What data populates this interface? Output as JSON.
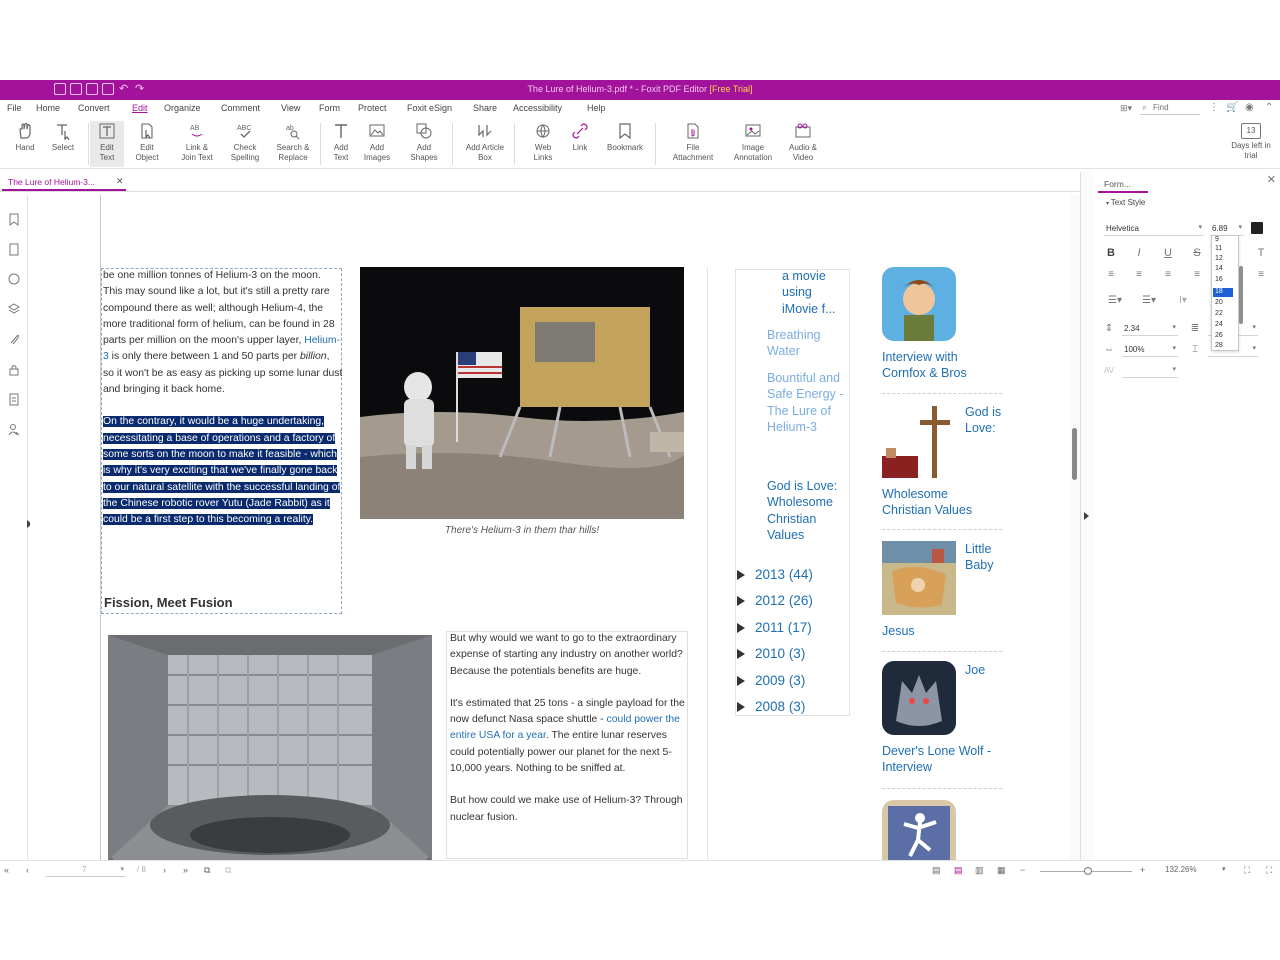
{
  "window": {
    "title": "The Lure of Helium-3.pdf * - Foxit PDF Editor",
    "trial_badge": "[Free Trial]"
  },
  "menu": [
    "File",
    "Home",
    "Convert",
    "Edit",
    "Organize",
    "Comment",
    "View",
    "Form",
    "Protect",
    "Foxit eSign",
    "Share",
    "Accessibility",
    "Help"
  ],
  "menu_active": "Edit",
  "search": {
    "placeholder": "Find"
  },
  "ribbon": {
    "tools": [
      {
        "label": "Hand"
      },
      {
        "label": "Select"
      },
      {
        "label": "Edit\nText"
      },
      {
        "label": "Edit\nObject"
      },
      {
        "label": "Link &\nJoin Text"
      },
      {
        "label": "Check\nSpelling"
      },
      {
        "label": "Search &\nReplace"
      },
      {
        "label": "Add\nText"
      },
      {
        "label": "Add\nImages"
      },
      {
        "label": "Add\nShapes"
      },
      {
        "label": "Add Article\nBox"
      },
      {
        "label": "Web\nLinks"
      },
      {
        "label": "Link"
      },
      {
        "label": "Bookmark"
      },
      {
        "label": "File\nAttachment"
      },
      {
        "label": "Image\nAnnotation"
      },
      {
        "label": "Audio &\nVideo"
      }
    ],
    "trial": {
      "days": "13",
      "label": "Days left in\ntrial"
    }
  },
  "tab": {
    "label": "The Lure of Helium-3..."
  },
  "article": {
    "para1_pre": "be one million tonnes of Helium-3 on the moon. This may sound like a lot, but it's still a pretty rare compound there as well; although Helium-4, the more traditional form of helium, can be found in 28 parts per million on the moon's upper layer, ",
    "para1_link": "Helium-3",
    "para1_mid": " is only there between 1 and 50 parts per ",
    "para1_em": "billion",
    "para1_post": ", so it won't be as easy as picking up some lunar dust and bringing it back home.",
    "para2_highlight": "On the contrary, it would be a huge undertaking, necessitating a base of operations and a factory of some sorts on the moon to make it feasible - which is why it's very exciting that we've finally gone back to our natural satellite with the successful landing of the Chinese robotic rover Yutu (Jade Rabbit) as it could be a first step to this becoming a reality.",
    "heading": "Fission, Meet Fusion",
    "caption": "There's Helium-3 in them thar hills!",
    "col2_p1": "But why would we want to go to the extraordinary expense of starting any industry on another world? Because the potentials benefits are huge.",
    "col2_p2_pre": "It's estimated that 25 tons - a single payload for the now defunct Nasa space shuttle - ",
    "col2_p2_link": "could power the entire USA for a year",
    "col2_p2_post": ". The entire lunar reserves could potentially power our planet for the next 5-10,000 years. Nothing to be sniffed at.",
    "col2_p3": "But how could we make use of Helium-3? Through nuclear fusion."
  },
  "sidebar": {
    "posts": [
      "a movie using iMovie f...",
      "Breathing Water",
      "Bountiful and Safe Energy - The Lure of Helium-3",
      "God is Love: Wholesome Christian Values"
    ],
    "archive": [
      {
        "year": "2013",
        "count": "(44)"
      },
      {
        "year": "2012",
        "count": "(26)"
      },
      {
        "year": "2011",
        "count": "(17)"
      },
      {
        "year": "2010",
        "count": "(3)"
      },
      {
        "year": "2009",
        "count": "(3)"
      },
      {
        "year": "2008",
        "count": "(3)"
      }
    ],
    "feature1": "Interview with Cornfox & Bros",
    "feature2_a": "God is Love:",
    "feature2_b": "Wholesome Christian Values",
    "feature3_a": "Little Baby",
    "feature3_b": "Jesus",
    "feature4_a": "Joe",
    "feature4_b": "Dever's Lone Wolf - Interview"
  },
  "format_panel": {
    "tab": "Form...",
    "header": "Text Style",
    "font": "Helvetica",
    "size": "6.89",
    "size_options": [
      "9",
      "11",
      "12",
      "14",
      "16",
      "18",
      "20",
      "22",
      "24",
      "26",
      "28"
    ],
    "selected_size": "18",
    "line_spacing": "2.34",
    "scale": "100%",
    "color": "#222222"
  },
  "status": {
    "page_input": "7",
    "page_total": "/ 8",
    "zoom": "132.26%"
  },
  "colors": {
    "accent": "#a3129a",
    "link": "#1f6fb3",
    "highlight": "#0a2a6e"
  }
}
